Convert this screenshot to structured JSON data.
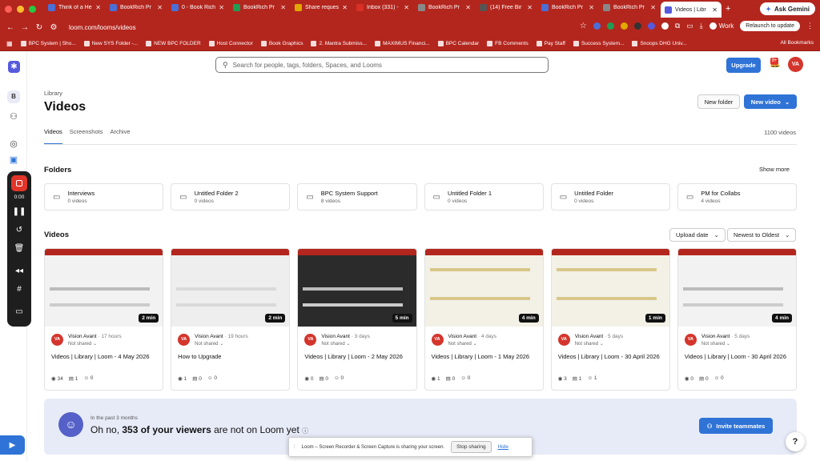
{
  "browser": {
    "tabs": [
      {
        "title": "Think of a He",
        "color": "#4b6fd6"
      },
      {
        "title": "BookRich Pr",
        "color": "#4b6fd6"
      },
      {
        "title": "0 - Book Rich",
        "color": "#4b6fd6"
      },
      {
        "title": "BookRich Pr",
        "color": "#1f9d55"
      },
      {
        "title": "Share reques",
        "color": "#e0a800"
      },
      {
        "title": "Inbox (331) -",
        "color": "#d93025"
      },
      {
        "title": "BookRich Pr",
        "color": "#888888"
      },
      {
        "title": "(14) Free Bir",
        "color": "#555555"
      },
      {
        "title": "BookRich Pr",
        "color": "#4b6fd6"
      },
      {
        "title": "BookRich Pr",
        "color": "#888888"
      },
      {
        "title": "Videos | Libr",
        "color": "#565add",
        "active": true
      }
    ],
    "ask_gemini": "Ask Gemini",
    "url": "loom.com/looms/videos",
    "profile": "Work",
    "relaunch": "Relaunch to update",
    "bookmarks": [
      "BPC System | Sho...",
      "New SYS Folder -...",
      "NEW BPC FOLDER",
      "Host Connector",
      "Book Graphics",
      "2. Mantra Submiss...",
      "MAXIMUS Financi...",
      "BPC Calendar",
      "FB Comments",
      "Pay Staff",
      "Success System...",
      "Snoops DHG Univ..."
    ],
    "all_bookmarks": "All Bookmarks"
  },
  "sidebar": {
    "workspace_initial": "B",
    "recorder_time": "0:00"
  },
  "header": {
    "search_placeholder": "Search for people, tags, folders, Spaces, and Looms",
    "upgrade": "Upgrade",
    "notification_badge": "9+",
    "user_initials": "VA"
  },
  "page": {
    "breadcrumb": "Library",
    "title": "Videos",
    "new_folder": "New folder",
    "new_video": "New video",
    "tabs": [
      "Videos",
      "Screenshots",
      "Archive"
    ],
    "active_tab": "Videos",
    "video_count": "1100 videos"
  },
  "folders_section": {
    "heading": "Folders",
    "show_more": "Show more",
    "items": [
      {
        "name": "Interviews",
        "count": "0 videos"
      },
      {
        "name": "Untitled Folder 2",
        "count": "0 videos"
      },
      {
        "name": "BPC System Support",
        "count": "8 videos"
      },
      {
        "name": "Untitled Folder 1",
        "count": "0 videos"
      },
      {
        "name": "Untitled Folder",
        "count": "0 videos"
      },
      {
        "name": "PM for Collabs",
        "count": "4 videos"
      }
    ]
  },
  "videos_section": {
    "heading": "Videos",
    "sort_field": "Upload date",
    "sort_order": "Newest to Oldest",
    "items": [
      {
        "duration": "2 min",
        "author": "Vision Avant",
        "ago": "· 17 hours",
        "sharing": "Not shared",
        "title": "Videos | Library | Loom - 4 May 2026",
        "views": "34",
        "comments": "1",
        "reactions": "0",
        "thumb": "ui"
      },
      {
        "duration": "2 min",
        "author": "Vision Avant",
        "ago": "· 19 hours",
        "sharing": "Not shared",
        "title": "How to Upgrade",
        "views": "1",
        "comments": "0",
        "reactions": "0",
        "thumb": "grid"
      },
      {
        "duration": "5 min",
        "author": "Vision Avant",
        "ago": "· 3 days",
        "sharing": "Not shared",
        "title": "Videos | Library | Loom - 2 May 2026",
        "views": "0",
        "comments": "0",
        "reactions": "0",
        "thumb": "dark"
      },
      {
        "duration": "4 min",
        "author": "Vision Avant",
        "ago": "· 4 days",
        "sharing": "Not shared",
        "title": "Videos | Library | Loom - 1 May 2026",
        "views": "1",
        "comments": "0",
        "reactions": "0",
        "thumb": "sheet"
      },
      {
        "duration": "1 min",
        "author": "Vision Avant",
        "ago": "· 5 days",
        "sharing": "Not shared",
        "title": "Videos | Library | Loom - 30 April 2026",
        "views": "3",
        "comments": "1",
        "reactions": "1",
        "thumb": "sheet"
      },
      {
        "duration": "4 min",
        "author": "Vision Avant",
        "ago": "· 5 days",
        "sharing": "Not shared",
        "title": "Videos | Library | Loom - 30 April 2026",
        "views": "0",
        "comments": "0",
        "reactions": "0",
        "thumb": "ui"
      }
    ]
  },
  "banner": {
    "small": "In the past 3 months",
    "prefix": "Oh no, ",
    "highlight": "353 of your viewers",
    "suffix": " are not on Loom yet",
    "invite": "Invite teammates"
  },
  "share_bar": {
    "text": "Loom – Screen Recorder & Screen Capture is sharing your screen.",
    "stop": "Stop sharing",
    "hide": "Hide"
  },
  "help": "?",
  "colors": {
    "brand": "#2f73d6",
    "chrome": "#b3261e",
    "loom": "#565add"
  }
}
